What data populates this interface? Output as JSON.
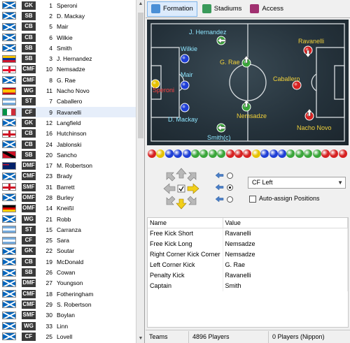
{
  "roster": [
    {
      "flag": "sco",
      "pos": "GK",
      "num": "1",
      "name": "Speroni"
    },
    {
      "flag": "sco",
      "pos": "SB",
      "num": "2",
      "name": "D. Mackay"
    },
    {
      "flag": "sco",
      "pos": "CB",
      "num": "5",
      "name": "Mair"
    },
    {
      "flag": "sco",
      "pos": "CB",
      "num": "6",
      "name": "Wilkie"
    },
    {
      "flag": "sco",
      "pos": "SB",
      "num": "4",
      "name": "Smith"
    },
    {
      "flag": "ven",
      "pos": "SB",
      "num": "3",
      "name": "J. Hernandez"
    },
    {
      "flag": "geo",
      "pos": "CMF",
      "num": "10",
      "name": "Nemsadze"
    },
    {
      "flag": "sco",
      "pos": "CMF",
      "num": "8",
      "name": "G. Rae"
    },
    {
      "flag": "esp",
      "pos": "WG",
      "num": "11",
      "name": "Nacho Novo"
    },
    {
      "flag": "arg",
      "pos": "ST",
      "num": "7",
      "name": "Caballero"
    },
    {
      "flag": "ita",
      "pos": "CF",
      "num": "9",
      "name": "Ravanelli",
      "selected": true
    },
    {
      "flag": "sco",
      "pos": "GK",
      "num": "12",
      "name": "Langfield"
    },
    {
      "flag": "eng",
      "pos": "CB",
      "num": "16",
      "name": "Hutchinson"
    },
    {
      "flag": "sco",
      "pos": "CB",
      "num": "24",
      "name": "Jablonski"
    },
    {
      "flag": "tto",
      "pos": "SB",
      "num": "20",
      "name": "Sancho"
    },
    {
      "flag": "aus",
      "pos": "DMF",
      "num": "17",
      "name": "M. Robertson"
    },
    {
      "flag": "sco",
      "pos": "CMF",
      "num": "23",
      "name": "Brady"
    },
    {
      "flag": "eng",
      "pos": "SMF",
      "num": "31",
      "name": "Barrett"
    },
    {
      "flag": "sco",
      "pos": "OMF",
      "num": "28",
      "name": "Burley"
    },
    {
      "flag": "ger",
      "pos": "OMF",
      "num": "14",
      "name": "Kneißl"
    },
    {
      "flag": "sco",
      "pos": "WG",
      "num": "21",
      "name": "Robb"
    },
    {
      "flag": "arg",
      "pos": "ST",
      "num": "15",
      "name": "Carranza"
    },
    {
      "flag": "arg",
      "pos": "CF",
      "num": "25",
      "name": "Sara"
    },
    {
      "flag": "sco",
      "pos": "GK",
      "num": "22",
      "name": "Soutar"
    },
    {
      "flag": "sco",
      "pos": "CB",
      "num": "19",
      "name": "McDonald"
    },
    {
      "flag": "sco",
      "pos": "SB",
      "num": "26",
      "name": "Cowan"
    },
    {
      "flag": "sco",
      "pos": "DMF",
      "num": "27",
      "name": "Youngson"
    },
    {
      "flag": "sco",
      "pos": "CMF",
      "num": "18",
      "name": "Fotheringham"
    },
    {
      "flag": "sco",
      "pos": "CMF",
      "num": "29",
      "name": "S. Robertson"
    },
    {
      "flag": "sco",
      "pos": "SMF",
      "num": "30",
      "name": "Boylan"
    },
    {
      "flag": "sco",
      "pos": "WG",
      "num": "33",
      "name": "Linn"
    },
    {
      "flag": "sco",
      "pos": "CF",
      "num": "25",
      "name": "Lovell"
    }
  ],
  "tabs": [
    {
      "label": "Formation",
      "icon": "formation-icon",
      "active": true
    },
    {
      "label": "Stadiums",
      "icon": "stadium-icon",
      "active": false
    },
    {
      "label": "Access",
      "icon": "access-icon",
      "active": false
    }
  ],
  "pitch_players": [
    {
      "name": "J. Hernandez",
      "color": "green",
      "arrow": "left"
    },
    {
      "name": "Wilkie",
      "color": "blue",
      "arrow": "none"
    },
    {
      "name": "G. Rae",
      "color": "green",
      "arrow": "up"
    },
    {
      "name": "Mair",
      "color": "blue",
      "arrow": "none"
    },
    {
      "name": "Speroni",
      "color": "yellow",
      "arrow": "none"
    },
    {
      "name": "Nemsadze",
      "color": "green",
      "arrow": "up"
    },
    {
      "name": "D. Mackay",
      "color": "blue",
      "arrow": "none"
    },
    {
      "name": "Smith(c)",
      "color": "green",
      "arrow": "left"
    },
    {
      "name": "Ravanelli",
      "color": "red",
      "arrow": "down"
    },
    {
      "name": "Caballero",
      "color": "red",
      "arrow": "none"
    },
    {
      "name": "Nacho Novo",
      "color": "red",
      "arrow": "up"
    }
  ],
  "color_balls": [
    "red",
    "yellow",
    "blue",
    "blue",
    "blue",
    "green",
    "green",
    "green",
    "green",
    "red",
    "red",
    "red",
    "yellow",
    "blue",
    "blue",
    "blue",
    "green",
    "green",
    "green",
    "green",
    "red",
    "red",
    "red"
  ],
  "controls": {
    "position_select": "CF Left",
    "auto_assign_label": "Auto-assign Positions",
    "auto_assign_checked": false,
    "radio_selected": 1
  },
  "set_pieces": {
    "headers": [
      "Name",
      "Value"
    ],
    "rows": [
      [
        "Free Kick Short",
        "Ravanelli"
      ],
      [
        "Free Kick Long",
        "Nemsadze"
      ],
      [
        "Right Corner Kick Corner",
        "Nemsadze"
      ],
      [
        "Left Corner Kick",
        "G. Rae"
      ],
      [
        "Penalty Kick",
        "Ravanelli"
      ],
      [
        "Captain",
        "Smith"
      ]
    ]
  },
  "status": {
    "teams": "Teams",
    "players": "4896 Players",
    "nippon": "0 Players (Nippon)"
  },
  "colors": {
    "green": "#3aa63a",
    "blue": "#1f3fd6",
    "yellow": "#e6c200",
    "red": "#d62222",
    "name_cyan": "#8fe6ff",
    "name_yellow": "#f2d23a",
    "name_red": "#ff4444"
  }
}
